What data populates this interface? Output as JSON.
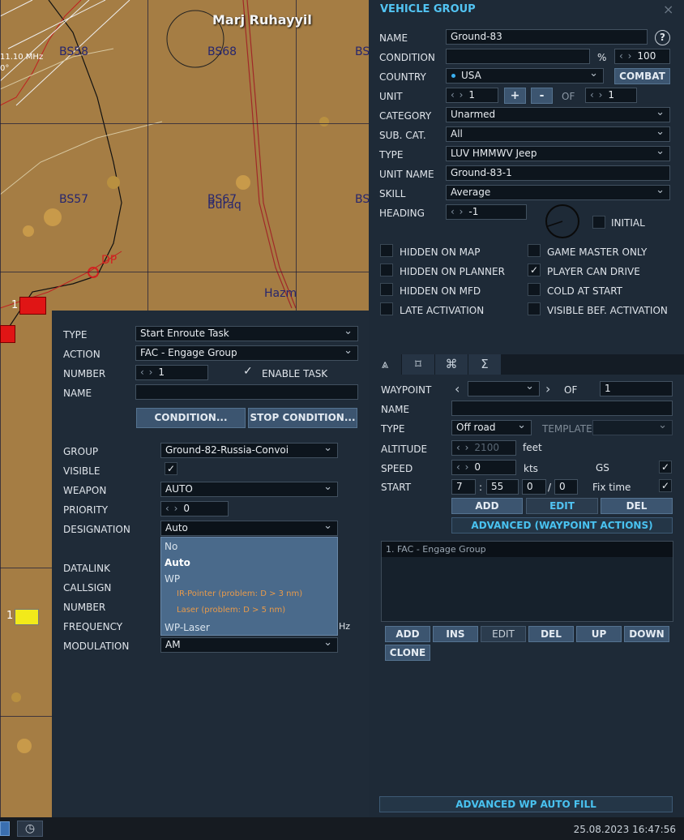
{
  "map": {
    "places": [
      "Marj Ruhayyil",
      "Buraq",
      "Hazm"
    ],
    "grids": [
      "BS58",
      "BS68",
      "BS",
      "BS57",
      "BS67",
      "BS"
    ],
    "freq": "11.10 MHz",
    "freq2": "0°",
    "waypoint": "DP",
    "unit1": "1",
    "unit2": "1"
  },
  "vehicle": {
    "title": "VEHICLE GROUP",
    "close": "×",
    "name_label": "NAME",
    "name_value": "Ground-83",
    "help": "?",
    "condition_label": "CONDITION",
    "condition_value": "",
    "pct": "%",
    "prob": "100",
    "country_label": "COUNTRY",
    "country_value": "USA",
    "combat": "COMBAT",
    "unit_label": "UNIT",
    "unit_value": "1",
    "plus": "+",
    "minus": "-",
    "of": "OF",
    "unit_of": "1",
    "category_label": "CATEGORY",
    "category_value": "Unarmed",
    "subcat_label": "SUB. CAT.",
    "subcat_value": "All",
    "type_label": "TYPE",
    "type_value": "LUV HMMWV Jeep",
    "unitname_label": "UNIT NAME",
    "unitname_value": "Ground-83-1",
    "skill_label": "SKILL",
    "skill_value": "Average",
    "heading_label": "HEADING",
    "heading_value": "-1",
    "initial": "INITIAL",
    "checks": [
      {
        "label": "HIDDEN ON MAP",
        "checked": false
      },
      {
        "label": "HIDDEN ON PLANNER",
        "checked": false
      },
      {
        "label": "HIDDEN ON MFD",
        "checked": false
      },
      {
        "label": "LATE ACTIVATION",
        "checked": false
      },
      {
        "label": "GAME MASTER ONLY",
        "checked": false
      },
      {
        "label": "PLAYER CAN DRIVE",
        "checked": true
      },
      {
        "label": "COLD AT START",
        "checked": false
      },
      {
        "label": "VISIBLE BEF. ACTIVATION",
        "checked": false
      }
    ]
  },
  "tabs": [
    "⩓",
    "⌑",
    "⌘",
    "Σ"
  ],
  "wp": {
    "waypoint_label": "WAYPOINT",
    "of": "OF",
    "of_value": "1",
    "name_label": "NAME",
    "type_label": "TYPE",
    "type_value": "Off road",
    "template_label": "TEMPLATE",
    "alt_label": "ALTITUDE",
    "alt_value": "2100",
    "alt_unit": "feet",
    "speed_label": "SPEED",
    "speed_value": "0",
    "speed_unit": "kts",
    "gs": "GS",
    "start_label": "START",
    "h": "7",
    "m": "55",
    "s": "0",
    "d": "0",
    "colon": ":",
    "slash": "/",
    "fixtime": "Fix time",
    "add": "ADD",
    "edit": "EDIT",
    "del": "DEL",
    "advanced": "ADVANCED (WAYPOINT ACTIONS)",
    "actions": [
      "1. FAC - Engage Group"
    ],
    "add2": "ADD",
    "ins": "INS",
    "edit2": "EDIT",
    "del2": "DEL",
    "up": "UP",
    "down": "DOWN",
    "clone": "CLONE",
    "autofill": "ADVANCED WP AUTO FILL"
  },
  "task": {
    "type_label": "TYPE",
    "type_value": "Start Enroute Task",
    "action_label": "ACTION",
    "action_value": "FAC - Engage Group",
    "number_label": "NUMBER",
    "number_value": "1",
    "enable": "ENABLE TASK",
    "name_label": "NAME",
    "name_value": "",
    "condition_btn": "CONDITION...",
    "stop_btn": "STOP CONDITION...",
    "group_label": "GROUP",
    "group_value": "Ground-82-Russia-Convoi",
    "visible_label": "VISIBLE",
    "weapon_label": "WEAPON",
    "weapon_value": "AUTO",
    "priority_label": "PRIORITY",
    "priority_value": "0",
    "designation_label": "DESIGNATION",
    "designation_value": "Auto",
    "datalink_label": "DATALINK",
    "callsign_label": "CALLSIGN",
    "number2_label": "NUMBER",
    "frequency_label": "FREQUENCY",
    "freq_unit": "Hz",
    "modulation_label": "MODULATION",
    "modulation_value": "AM",
    "options": [
      "No",
      "Auto",
      "WP",
      "IR-Pointer (problem: D > 3 nm)",
      "Laser (problem: D > 5 nm)",
      "WP-Laser"
    ]
  },
  "status": {
    "datetime": "25.08.2023 16:47:56"
  }
}
